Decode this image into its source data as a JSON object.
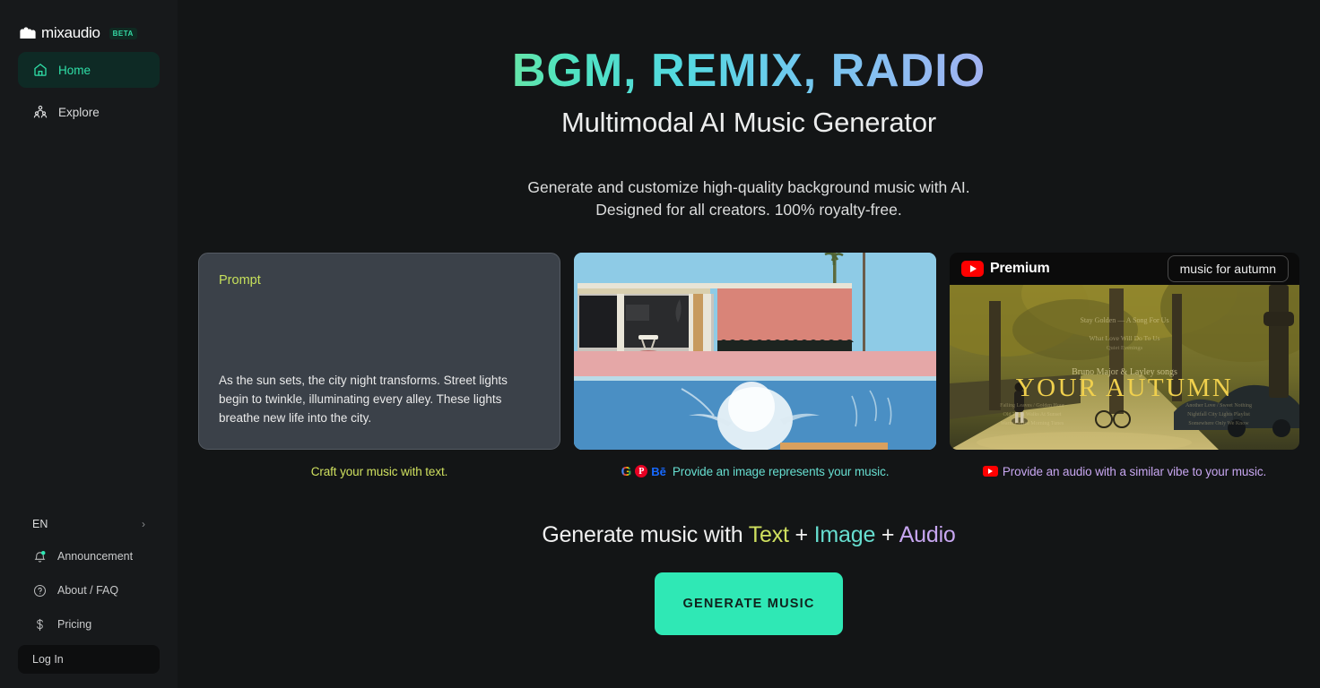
{
  "brand": {
    "name": "mixaudio",
    "badge": "BETA",
    "logo_icon": "mixaudio-logo-icon"
  },
  "sidebar": {
    "nav": [
      {
        "label": "Home",
        "icon": "home-icon",
        "active": true
      },
      {
        "label": "Explore",
        "icon": "explore-people-icon",
        "active": false
      }
    ],
    "language": {
      "label": "EN",
      "chevron": "›"
    },
    "links": [
      {
        "label": "Announcement",
        "icon": "bell-icon"
      },
      {
        "label": "About / FAQ",
        "icon": "question-circle-icon"
      },
      {
        "label": "Pricing",
        "icon": "dollar-icon"
      }
    ],
    "login_label": "Log In"
  },
  "hero": {
    "title": "BGM, REMIX, RADIO",
    "subtitle": "Multimodal AI Music Generator",
    "description_line1": "Generate and customize high-quality background music with AI.",
    "description_line2": "Designed for all creators. 100% royalty-free."
  },
  "cards": {
    "prompt": {
      "label": "Prompt",
      "text": "As the sun sets, the city night transforms. Street lights begin to twinkle, illuminating every alley. These lights breathe new life into the city.",
      "caption": "Craft your music with text."
    },
    "image": {
      "alt": "poolside-house-splash-painting",
      "caption": "Provide an image represents your music.",
      "source_icons": [
        "google-icon",
        "pinterest-icon",
        "behance-icon"
      ]
    },
    "audio": {
      "yt_brand": "Premium",
      "yt_chip": "music for autumn",
      "thumb_title": "YOUR AUTUMN",
      "thumb_artist": "Bruno Major & Layley songs",
      "caption": "Provide an audio with a similar vibe to your music.",
      "source_icon": "youtube-icon"
    }
  },
  "generate": {
    "prefix": "Generate music with ",
    "text_word": "Text",
    "plus1": " + ",
    "image_word": "Image",
    "plus2": " + ",
    "audio_word": "Audio",
    "button_label": "GENERATE MUSIC"
  },
  "colors": {
    "accent_green": "#2fe8b5",
    "text_yellow": "#cfe05f",
    "image_teal": "#67ded0",
    "audio_purple": "#c7a6f0",
    "background": "#131516",
    "sidebar": "#17191b"
  }
}
